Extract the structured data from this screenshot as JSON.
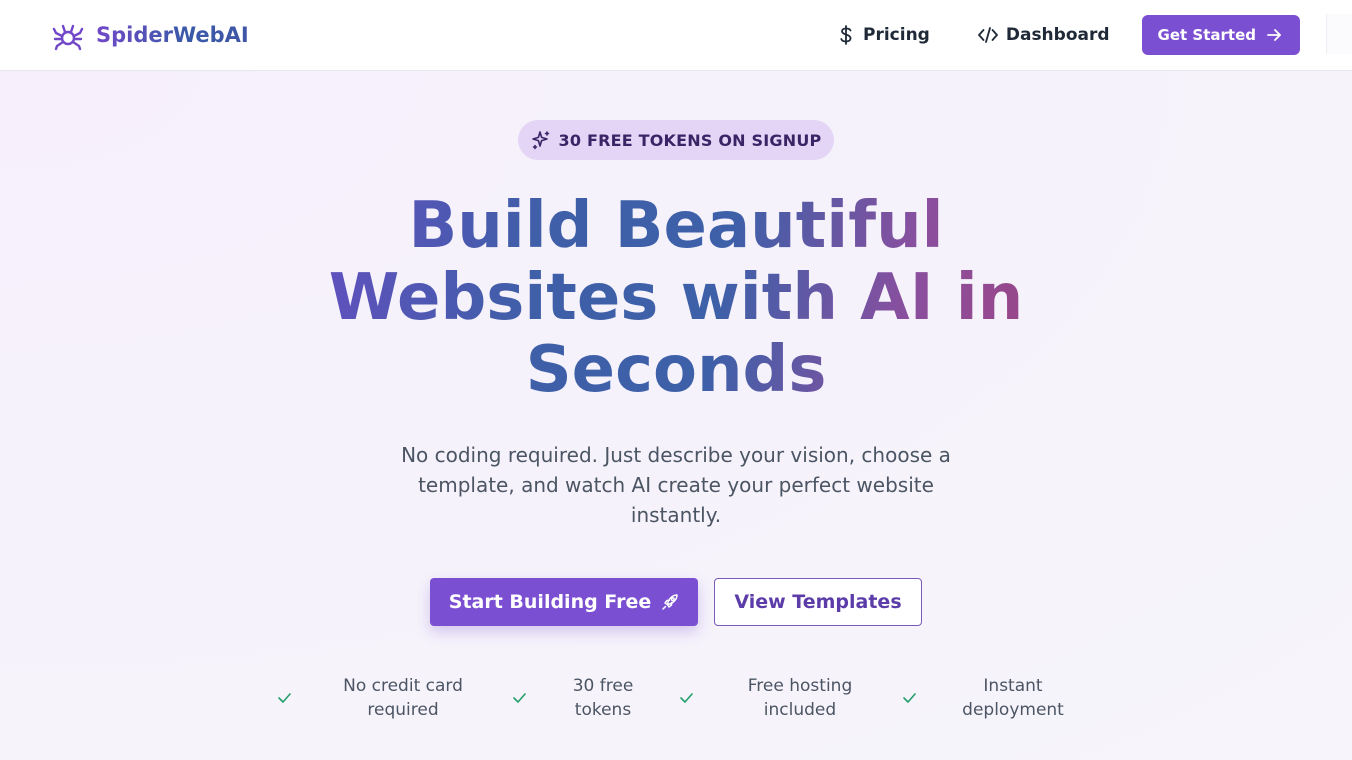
{
  "header": {
    "brand": "SpiderWebAI",
    "nav": {
      "pricing": "Pricing",
      "dashboard": "Dashboard",
      "get_started": "Get Started"
    }
  },
  "hero": {
    "badge": "30 FREE TOKENS ON SIGNUP",
    "headline": "Build Beautiful Websites with AI in Seconds",
    "subtitle": "No coding required. Just describe your vision, choose a template, and watch AI create your perfect website instantly.",
    "primary_cta": "Start Building Free",
    "secondary_cta": "View Templates"
  },
  "features": [
    {
      "label": "No credit card required",
      "icon": "check-icon"
    },
    {
      "label": "30 free tokens",
      "icon": "check-icon"
    },
    {
      "label": "Free hosting included",
      "icon": "check-icon"
    },
    {
      "label": "Instant deployment",
      "icon": "check-icon"
    }
  ],
  "icons": {
    "logo": "spider-icon",
    "pricing": "dollar-icon",
    "dashboard": "code-icon",
    "get_started": "arrow-right-icon",
    "badge": "sparkles-icon",
    "primary_cta": "rocket-icon"
  },
  "colors": {
    "accent": "#7b4fd1",
    "badge_bg": "#e4d5f7",
    "check": "#22a06b",
    "text": "#1f2937",
    "muted": "#4b5563"
  }
}
